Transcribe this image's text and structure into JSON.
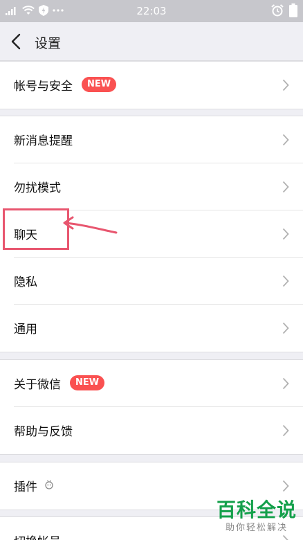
{
  "status_bar": {
    "time": "22:03"
  },
  "nav": {
    "title": "设置"
  },
  "groups": [
    {
      "items": [
        {
          "label": "帐号与安全",
          "badge": "NEW"
        }
      ]
    },
    {
      "items": [
        {
          "label": "新消息提醒"
        },
        {
          "label": "勿扰模式"
        },
        {
          "label": "聊天"
        },
        {
          "label": "隐私"
        },
        {
          "label": "通用"
        }
      ]
    },
    {
      "items": [
        {
          "label": "关于微信",
          "badge": "NEW"
        },
        {
          "label": "帮助与反馈"
        }
      ]
    },
    {
      "items": [
        {
          "label": "插件"
        }
      ]
    },
    {
      "items": [
        {
          "label": "切换帐号"
        }
      ]
    }
  ],
  "watermark": {
    "main": "百科全说",
    "sub": "助你轻松解决"
  },
  "colors": {
    "badge": "#fa5151",
    "highlight": "#e8566f",
    "watermark": "#14a04b",
    "background": "#efeff4"
  }
}
